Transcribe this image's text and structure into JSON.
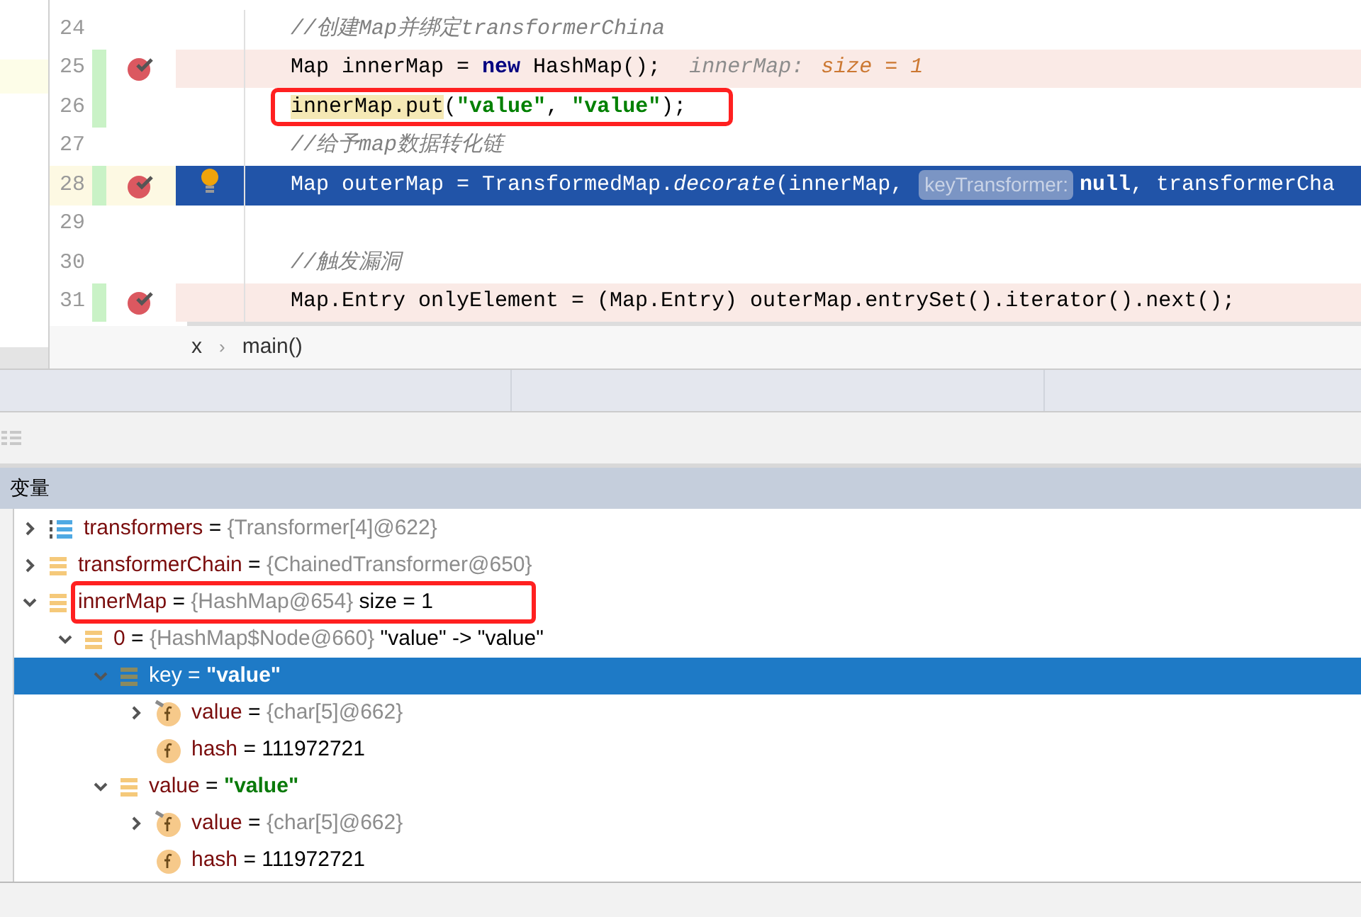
{
  "editor": {
    "lines": [
      {
        "number": "24",
        "breakpoint": false,
        "changed": false,
        "kind": "plain",
        "bulb": false,
        "boxed": false,
        "segments": [
          {
            "kind": "comment",
            "text": "//创建Map并绑定transformerChina"
          }
        ]
      },
      {
        "number": "25",
        "breakpoint": true,
        "changed": true,
        "kind": "breakpoint",
        "bulb": false,
        "boxed": false,
        "segments": [
          {
            "kind": "plain",
            "text": "Map innerMap = "
          },
          {
            "kind": "keyword",
            "text": "new"
          },
          {
            "kind": "plain",
            "text": " HashMap();"
          },
          {
            "kind": "inline_name",
            "text": "innerMap:"
          },
          {
            "kind": "inline_value",
            "text": "size = 1"
          }
        ]
      },
      {
        "number": "26",
        "breakpoint": false,
        "changed": true,
        "kind": "plain",
        "bulb": false,
        "boxed": true,
        "segments": [
          {
            "kind": "usage",
            "text": "innerMap.put"
          },
          {
            "kind": "plain",
            "text": "("
          },
          {
            "kind": "string",
            "text": "\"value\""
          },
          {
            "kind": "plain",
            "text": ", "
          },
          {
            "kind": "string",
            "text": "\"value\""
          },
          {
            "kind": "plain",
            "text": ");"
          }
        ]
      },
      {
        "number": "27",
        "breakpoint": false,
        "changed": false,
        "kind": "plain",
        "bulb": false,
        "boxed": false,
        "segments": [
          {
            "kind": "comment",
            "text": "//给予map数据转化链"
          }
        ]
      },
      {
        "number": "28",
        "breakpoint": true,
        "changed": true,
        "kind": "current",
        "bulb": true,
        "boxed": false,
        "segments": [
          {
            "kind": "plain",
            "text": "Map outerMap = TransformedMap."
          },
          {
            "kind": "static",
            "text": "decorate"
          },
          {
            "kind": "plain",
            "text": "(innerMap, "
          },
          {
            "kind": "hint",
            "text": "keyTransformer:"
          },
          {
            "kind": "keyword",
            "text": "null"
          },
          {
            "kind": "plain",
            "text": ", transformerCha"
          }
        ]
      },
      {
        "number": "29",
        "breakpoint": false,
        "changed": false,
        "kind": "plain",
        "bulb": false,
        "boxed": false
      },
      {
        "number": "30",
        "breakpoint": false,
        "changed": false,
        "kind": "plain",
        "bulb": false,
        "boxed": false,
        "segments": [
          {
            "kind": "comment",
            "text": "//触发漏洞"
          }
        ]
      },
      {
        "number": "31",
        "breakpoint": true,
        "changed": true,
        "kind": "breakpoint",
        "bulb": false,
        "boxed": false,
        "segments": [
          {
            "kind": "plain",
            "text": "Map.Entry onlyElement = (Map.Entry) outerMap.entrySet().iterator().next();"
          }
        ]
      }
    ]
  },
  "breadcrumb": {
    "separator": "›",
    "items": [
      "x",
      "main()"
    ]
  },
  "variables": {
    "title": "变量",
    "tree": [
      {
        "kind": "array",
        "name": "transformers",
        "operator": "=",
        "value": {
          "kind": "ref",
          "text": "{Transformer[4]@622}"
        },
        "expanded": false,
        "selected": false,
        "boxed": false
      },
      {
        "kind": "object",
        "name": "transformerChain",
        "operator": "=",
        "value": {
          "kind": "ref",
          "text": "{ChainedTransformer@650}"
        },
        "expanded": false,
        "selected": false,
        "boxed": false
      },
      {
        "kind": "object",
        "name": "innerMap",
        "operator": "=",
        "value": {
          "kind": "ref",
          "text": "{HashMap@654}"
        },
        "extra": "size = 1",
        "expanded": true,
        "selected": false,
        "boxed": true,
        "children": [
          {
            "kind": "object",
            "name": "0",
            "operator": "=",
            "value": {
              "kind": "ref",
              "text": "{HashMap$Node@660}"
            },
            "extra": "\"value\" -> \"value\"",
            "expanded": true,
            "selected": false,
            "boxed": false,
            "children": [
              {
                "kind": "object",
                "name": "key",
                "operator": "=",
                "value": {
                  "kind": "string",
                  "text": "\"value\""
                },
                "expanded": true,
                "selected": true,
                "boxed": false,
                "children": [
                  {
                    "kind": "final_field",
                    "name": "value",
                    "operator": "=",
                    "value": {
                      "kind": "ref",
                      "text": "{char[5]@662}"
                    },
                    "expanded": false,
                    "selected": false,
                    "boxed": false
                  },
                  {
                    "kind": "field",
                    "name": "hash",
                    "operator": "=",
                    "value": {
                      "kind": "plain",
                      "text": "111972721"
                    },
                    "selected": false,
                    "boxed": false
                  }
                ]
              },
              {
                "kind": "object",
                "name": "value",
                "operator": "=",
                "value": {
                  "kind": "string",
                  "text": "\"value\""
                },
                "expanded": true,
                "selected": false,
                "boxed": false,
                "children": [
                  {
                    "kind": "final_field",
                    "name": "value",
                    "operator": "=",
                    "value": {
                      "kind": "ref",
                      "text": "{char[5]@662}"
                    },
                    "expanded": false,
                    "selected": false,
                    "boxed": false
                  },
                  {
                    "kind": "field",
                    "name": "hash",
                    "operator": "=",
                    "value": {
                      "kind": "plain",
                      "text": "111972721"
                    },
                    "selected": false,
                    "boxed": false
                  }
                ]
              }
            ]
          }
        ]
      }
    ]
  }
}
